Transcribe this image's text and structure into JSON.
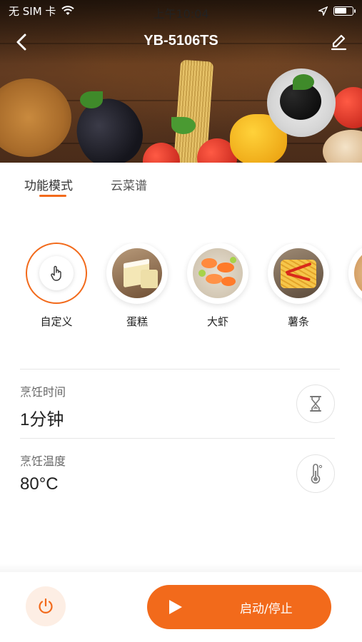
{
  "status_bar": {
    "carrier": "无 SIM 卡",
    "time": "上午10:04",
    "battery_level": 0.7
  },
  "nav": {
    "title": "YB-5106TS",
    "back_icon": "chevron-left-icon",
    "edit_icon": "pencil-icon"
  },
  "tabs": [
    {
      "label": "功能模式",
      "active": true
    },
    {
      "label": "云菜谱",
      "active": false
    }
  ],
  "modes": [
    {
      "label": "自定义",
      "icon": "hand-pointer-icon",
      "selected": true
    },
    {
      "label": "蛋糕",
      "icon": "cake-image",
      "selected": false
    },
    {
      "label": "大虾",
      "icon": "shrimp-image",
      "selected": false
    },
    {
      "label": "薯条",
      "icon": "fries-image",
      "selected": false
    }
  ],
  "settings": {
    "time": {
      "label": "烹饪时间",
      "value": "1分钟",
      "icon": "hourglass-icon"
    },
    "temperature": {
      "label": "烹饪温度",
      "value": "80°C",
      "icon": "thermometer-icon"
    }
  },
  "bottom": {
    "power_icon": "power-icon",
    "start_label": "启动/停止",
    "start_icon": "play-icon"
  },
  "colors": {
    "accent": "#f26a1b",
    "accent_light": "#fdeee4"
  }
}
